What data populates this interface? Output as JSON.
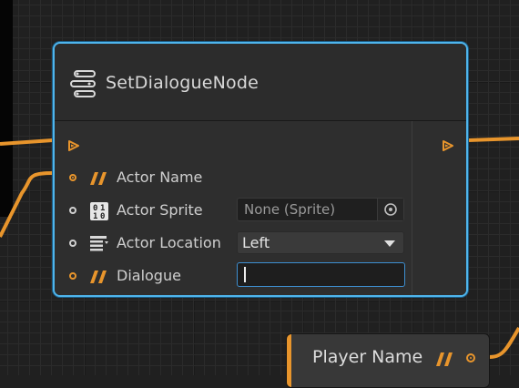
{
  "node": {
    "title": "SetDialogueNode",
    "rows": [
      {
        "label": "Actor Name"
      },
      {
        "label": "Actor Sprite",
        "field_value": "None (Sprite)"
      },
      {
        "label": "Actor Location",
        "dropdown_value": "Left"
      },
      {
        "label": "Dialogue",
        "input_value": ""
      }
    ],
    "sprite_icon_text": [
      "0",
      "1",
      "1",
      "0"
    ]
  },
  "player_node": {
    "label": "Player Name"
  },
  "colors": {
    "accent": "#e8952c",
    "selection": "#4fb5ec",
    "background": "#202020"
  },
  "icons": [
    "stack-icon",
    "exec-in-icon",
    "exec-out-icon",
    "string-icon",
    "binary-icon",
    "list-icon",
    "target-icon",
    "chevron-down-icon"
  ]
}
